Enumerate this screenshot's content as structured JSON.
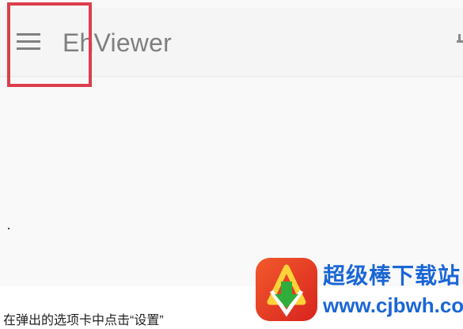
{
  "app": {
    "title": "EhViewer",
    "menu_icon": "hamburger-menu-icon",
    "highlight_color": "#dc3e4c",
    "title_color": "#7f7f7f",
    "toolbar_color": "#f5f5f5"
  },
  "caption": "在弹出的选项卡中点击“设置”",
  "watermark": {
    "name": "超级棒下载站",
    "url": "www.cjbwh.com",
    "logo_icon": "download-arrow-logo-icon",
    "brand_color": "#1a66d6",
    "logo_color": "#e8412a"
  }
}
